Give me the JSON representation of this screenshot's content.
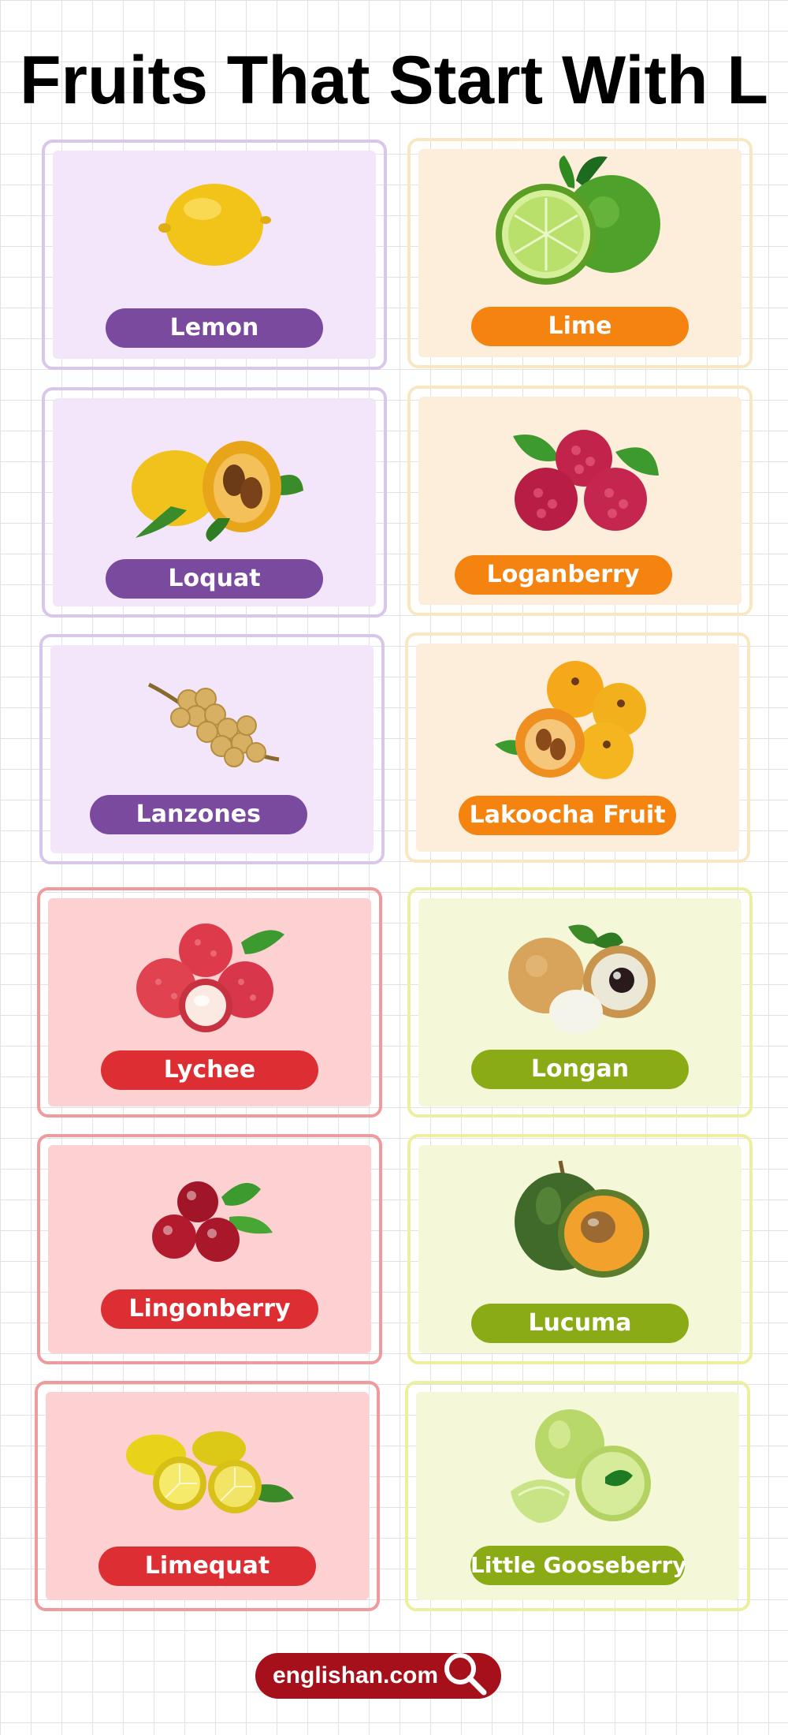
{
  "title": "Fruits That Start With L",
  "cards": [
    {
      "name": "Lemon"
    },
    {
      "name": "Lime"
    },
    {
      "name": "Loquat"
    },
    {
      "name": "Loganberry"
    },
    {
      "name": "Lanzones"
    },
    {
      "name": "Lakoocha Fruit"
    },
    {
      "name": "Lychee"
    },
    {
      "name": "Longan"
    },
    {
      "name": "Lingonberry"
    },
    {
      "name": "Lucuma"
    },
    {
      "name": "Limequat"
    },
    {
      "name": "Little Gooseberry"
    }
  ],
  "footer": {
    "site": "englishan.com"
  },
  "icons": [
    "lemon-icon",
    "lime-icon",
    "loquat-icon",
    "loganberry-icon",
    "lanzones-icon",
    "lakoocha-icon",
    "lychee-icon",
    "longan-icon",
    "lingonberry-icon",
    "lucuma-icon",
    "limequat-icon",
    "gooseberry-icon",
    "magnifier-icon"
  ]
}
